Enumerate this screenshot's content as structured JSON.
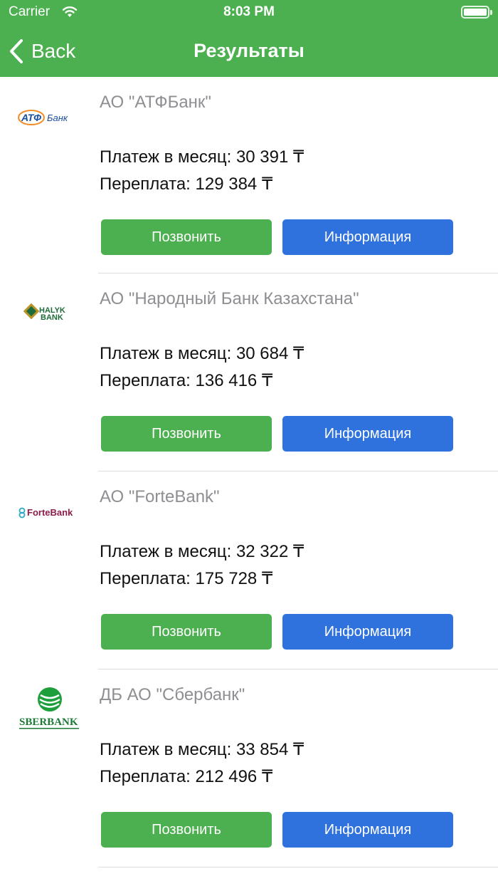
{
  "status_bar": {
    "carrier": "Carrier",
    "time": "8:03 PM"
  },
  "nav": {
    "back_label": "Back",
    "title": "Результаты"
  },
  "banks": [
    {
      "name": "АО \"АТФБанк\"",
      "payment": "Платеж в месяц: 30 391 ₸",
      "overpayment": "Переплата: 129 384 ₸",
      "call_label": "Позвонить",
      "info_label": "Информация",
      "logo_text": "АТФ Банк"
    },
    {
      "name": "АО \"Народный Банк Казахстана\"",
      "payment": "Платеж в месяц: 30 684 ₸",
      "overpayment": "Переплата: 136 416 ₸",
      "call_label": "Позвонить",
      "info_label": "Информация",
      "logo_text": "HALYK BANK"
    },
    {
      "name": "АО \"ForteBank\"",
      "payment": "Платеж в месяц: 32 322 ₸",
      "overpayment": "Переплата: 175 728 ₸",
      "call_label": "Позвонить",
      "info_label": "Информация",
      "logo_text": "ForteBank"
    },
    {
      "name": "ДБ АО \"Сбербанк\"",
      "payment": "Платеж в месяц: 33 854 ₸",
      "overpayment": "Переплата: 212 496 ₸",
      "call_label": "Позвонить",
      "info_label": "Информация",
      "logo_text": "SBERBANK"
    }
  ],
  "colors": {
    "header": "#4caf50",
    "call_button": "#4caf50",
    "info_button": "#2f72de"
  }
}
